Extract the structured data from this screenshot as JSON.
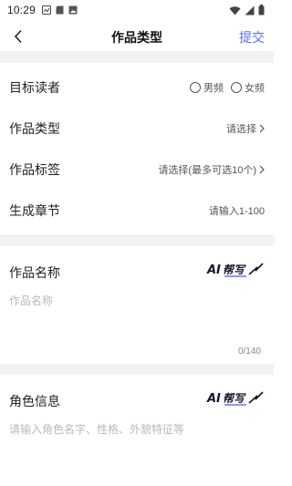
{
  "status_bar": {
    "time": "10:29",
    "left_icons": [
      "gallery-icon",
      "sd-card-icon",
      "photo-icon"
    ],
    "right_icons": [
      "wifi-icon",
      "signal-icon",
      "battery-icon"
    ]
  },
  "nav": {
    "back_icon": "chevron-left-icon",
    "title": "作品类型",
    "submit": "提交",
    "accent": "#5b6cf0"
  },
  "rows": {
    "reader": {
      "label": "目标读者",
      "options": [
        "男频",
        "女频"
      ]
    },
    "type": {
      "label": "作品类型",
      "value": "请选择"
    },
    "tags": {
      "label": "作品标签",
      "value": "请选择(最多可选10个)"
    },
    "chapters": {
      "label": "生成章节",
      "placeholder": "请输入1-100"
    }
  },
  "name_section": {
    "title": "作品名称",
    "logo_text": "AI帮写",
    "placeholder": "作品名称",
    "counter": "0/140"
  },
  "role_section": {
    "title": "角色信息",
    "logo_text": "AI帮写",
    "placeholder": "请输入角色名字、性格、外貌特征等"
  }
}
